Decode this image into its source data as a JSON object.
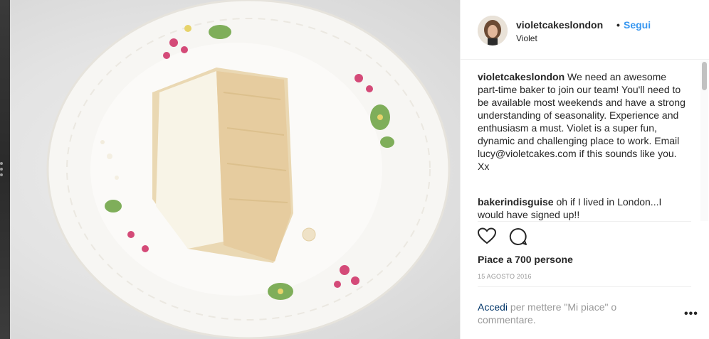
{
  "post": {
    "username": "violetcakeslondon",
    "bullet": "•",
    "follow_label": "Segui",
    "location": "Violet",
    "caption": {
      "author": "violetcakeslondon",
      "text": "We need an awesome part-time baker to join our team! You'll need to be available most weekends and have a strong understanding of seasonality. Experience and enthusiasm a must. Violet is a super fun, dynamic and challenging place to work. Email lucy@violetcakes.com if this sounds like you. Xx"
    },
    "comments": [
      {
        "author": "bakerindisguise",
        "text": "oh if I lived in London...I would have signed up!!"
      }
    ],
    "likes_label": "Piace a 700 persone",
    "date_label": "15 AGOSTO 2016",
    "login_prompt": {
      "link": "Accedi",
      "text": "per mettere \"Mi piace\" o commentare."
    },
    "more_label": "•••"
  },
  "icons": {
    "like": "heart-icon",
    "comment": "comment-icon",
    "more": "more-options-icon"
  },
  "colors": {
    "link_blue": "#3897f0",
    "text": "#262626",
    "muted": "#999999",
    "login_link": "#003569"
  }
}
